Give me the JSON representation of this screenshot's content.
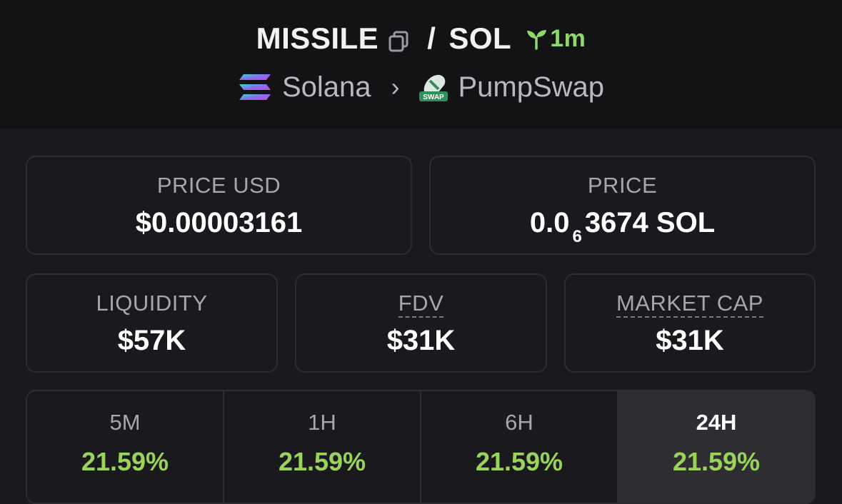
{
  "pair": {
    "base": "MISSILE",
    "separator": "/",
    "quote": "SOL",
    "age": "1m"
  },
  "chain": {
    "name": "Solana",
    "dex": "PumpSwap",
    "dex_logo_text": "SWAP"
  },
  "stats": {
    "price_usd": {
      "label": "PRICE USD",
      "value": "$0.00003161"
    },
    "price": {
      "label": "PRICE",
      "prefix": "0.0",
      "zeros": "6",
      "suffix": "3674 SOL"
    },
    "liquidity": {
      "label": "LIQUIDITY",
      "value": "$57K"
    },
    "fdv": {
      "label": "FDV",
      "value": "$31K"
    },
    "market_cap": {
      "label": "MARKET CAP",
      "value": "$31K"
    }
  },
  "changes": [
    {
      "timeframe": "5M",
      "percent": "21.59%"
    },
    {
      "timeframe": "1H",
      "percent": "21.59%"
    },
    {
      "timeframe": "6H",
      "percent": "21.59%"
    },
    {
      "timeframe": "24H",
      "percent": "21.59%",
      "selected": true
    }
  ],
  "colors": {
    "positive": "#9bd35a",
    "age_green": "#8fd86a",
    "background": "#1a1a1e",
    "header_bg": "#131316"
  }
}
